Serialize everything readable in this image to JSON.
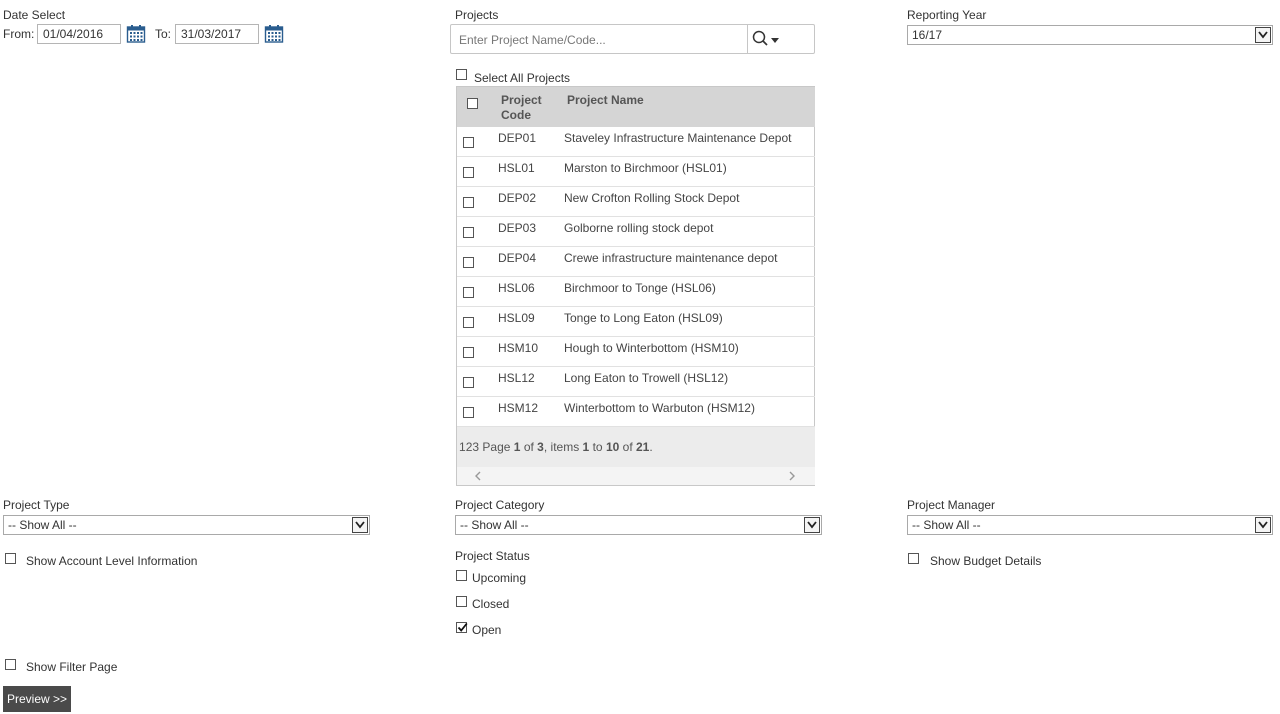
{
  "date_select": {
    "title": "Date Select",
    "from_label": "From:",
    "from_value": "01/04/2016",
    "to_label": "To:",
    "to_value": "31/03/2017"
  },
  "projects": {
    "title": "Projects",
    "search_placeholder": "Enter Project Name/Code...",
    "select_all_label": "Select All Projects",
    "columns": {
      "code": "Project Code",
      "name": "Project Name"
    },
    "rows": [
      {
        "code": "DEP01",
        "name": "Staveley Infrastructure Maintenance Depot"
      },
      {
        "code": "HSL01",
        "name": "Marston to Birchmoor (HSL01)"
      },
      {
        "code": "DEP02",
        "name": "New Crofton Rolling Stock Depot"
      },
      {
        "code": "DEP03",
        "name": "Golborne rolling stock depot"
      },
      {
        "code": "DEP04",
        "name": "Crewe infrastructure maintenance depot"
      },
      {
        "code": "HSL06",
        "name": "Birchmoor to Tonge (HSL06)"
      },
      {
        "code": "HSL09",
        "name": "Tonge to Long Eaton (HSL09)"
      },
      {
        "code": "HSM10",
        "name": "Hough to Winterbottom (HSM10)"
      },
      {
        "code": "HSL12",
        "name": "Long Eaton to Trowell (HSL12)"
      },
      {
        "code": "HSM12",
        "name": "Winterbottom to Warbuton (HSM12)"
      }
    ],
    "pager": {
      "pages": [
        "1",
        "2",
        "3"
      ],
      "page_word": "Page",
      "current_page": "1",
      "of_word": "of",
      "total_pages": "3",
      "items_word": ", items",
      "item_from": "1",
      "to_word": "to",
      "item_to": "10",
      "of_word2": "of",
      "total_items": "21",
      "period": "."
    }
  },
  "reporting_year": {
    "title": "Reporting Year",
    "value": "16/17"
  },
  "project_type": {
    "title": "Project Type",
    "value": "-- Show All --"
  },
  "project_category": {
    "title": "Project Category",
    "value": "-- Show All --"
  },
  "project_manager": {
    "title": "Project Manager",
    "value": "-- Show All --"
  },
  "show_account_level": {
    "label": "Show Account Level Information",
    "checked": false
  },
  "show_budget_details": {
    "label": "Show Budget Details",
    "checked": false
  },
  "project_status": {
    "title": "Project Status",
    "options": [
      {
        "label": "Upcoming",
        "checked": false
      },
      {
        "label": "Closed",
        "checked": false
      },
      {
        "label": "Open",
        "checked": true
      }
    ]
  },
  "show_filter_page": {
    "label": "Show Filter Page",
    "checked": false
  },
  "preview_button": {
    "label": "Preview >>"
  },
  "colors": {
    "button_bg": "#4a4a4a",
    "grid_header_bg": "#d5d5d5",
    "pager_bg": "#ececec"
  }
}
